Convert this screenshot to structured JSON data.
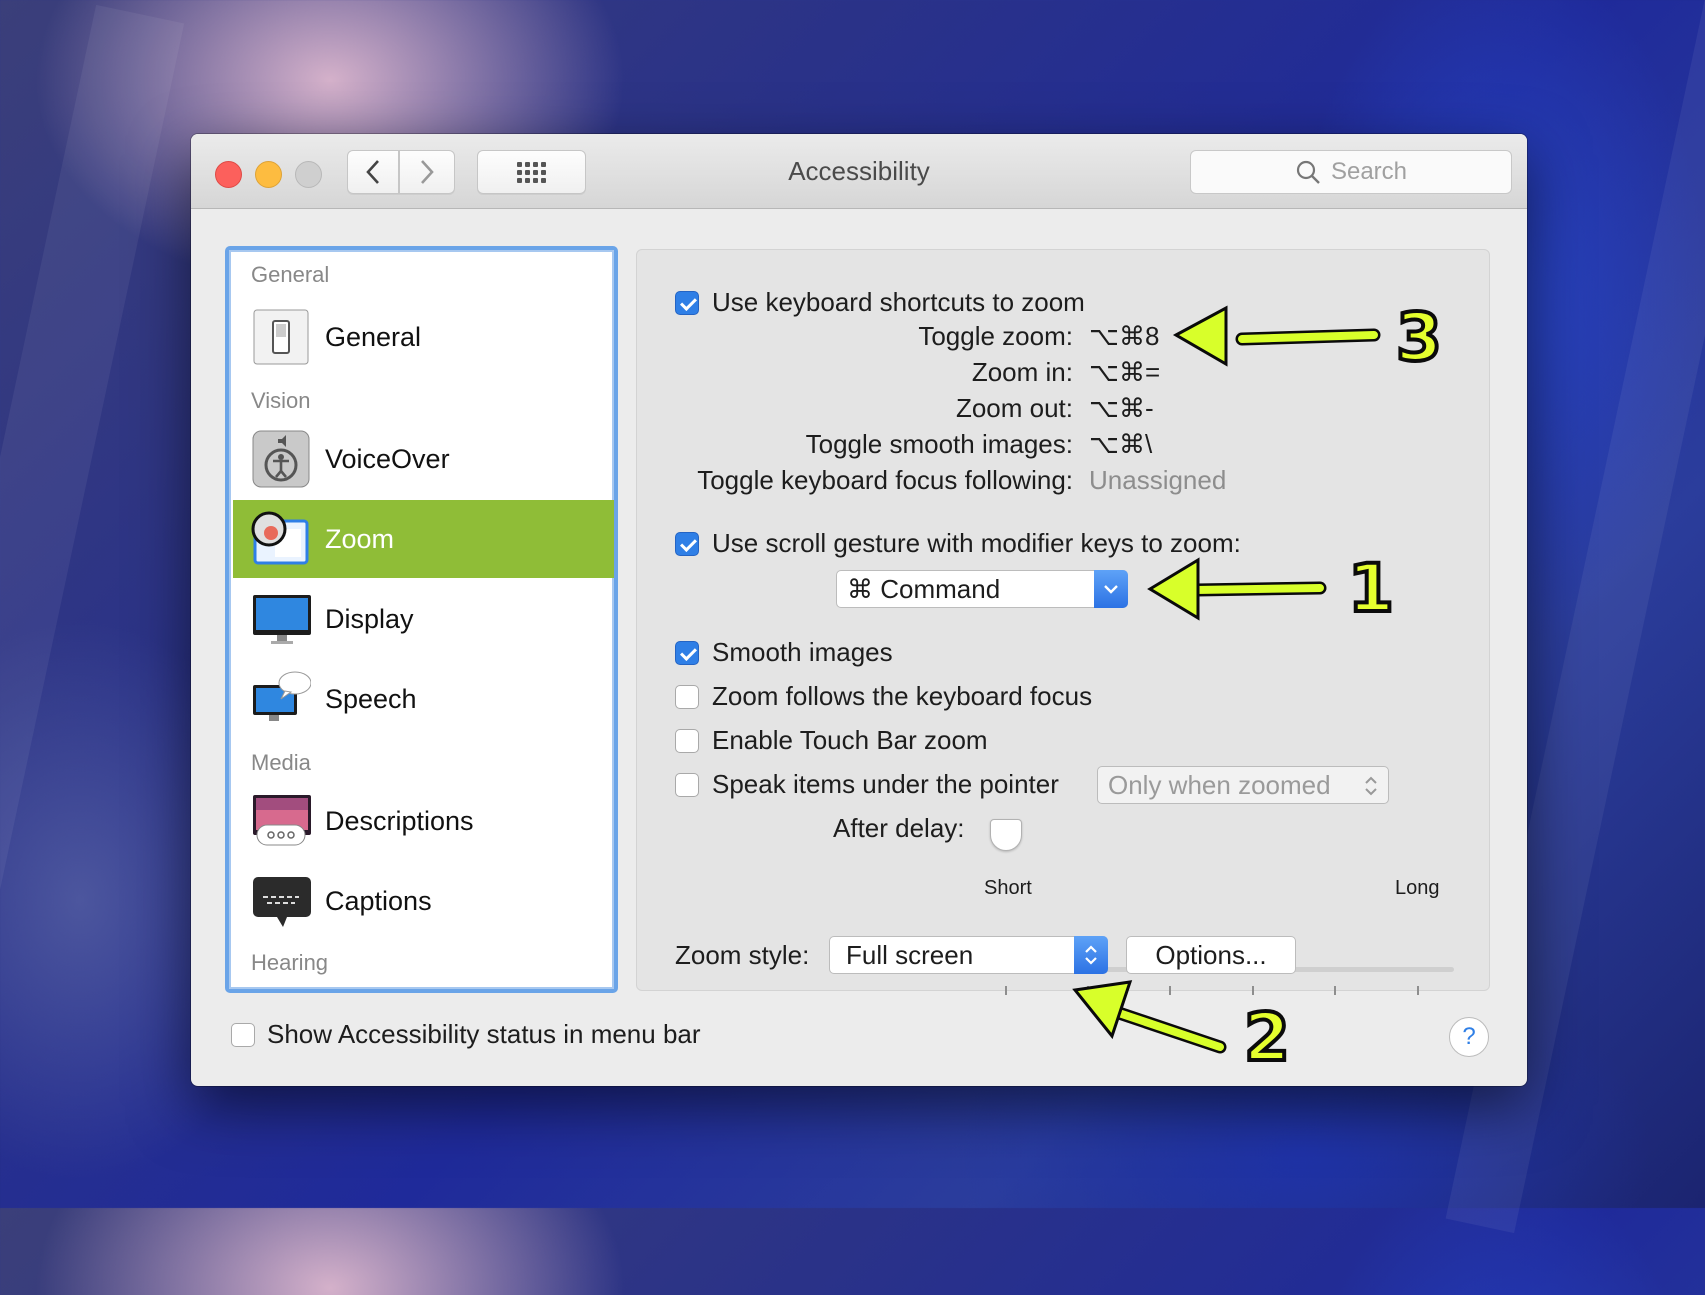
{
  "window": {
    "title": "Accessibility",
    "search_placeholder": "Search"
  },
  "sidebar": {
    "sections": [
      {
        "label": "General"
      },
      {
        "label": "Vision"
      },
      {
        "label": "Media"
      },
      {
        "label": "Hearing"
      }
    ],
    "items": [
      {
        "label": "General",
        "icon": "switch-icon"
      },
      {
        "label": "VoiceOver",
        "icon": "voiceover-icon"
      },
      {
        "label": "Zoom",
        "icon": "zoom-icon",
        "selected": true
      },
      {
        "label": "Display",
        "icon": "display-icon"
      },
      {
        "label": "Speech",
        "icon": "speech-icon"
      },
      {
        "label": "Descriptions",
        "icon": "descriptions-icon"
      },
      {
        "label": "Captions",
        "icon": "captions-icon"
      }
    ],
    "selection_color": "#8fbd37"
  },
  "zoom": {
    "use_keyboard_shortcuts": {
      "label": "Use keyboard shortcuts to zoom",
      "checked": true
    },
    "shortcuts": [
      {
        "label": "Toggle zoom:",
        "value": "⌥⌘8"
      },
      {
        "label": "Zoom in:",
        "value": "⌥⌘="
      },
      {
        "label": "Zoom out:",
        "value": "⌥⌘-"
      },
      {
        "label": "Toggle smooth images:",
        "value": "⌥⌘\\"
      },
      {
        "label": "Toggle keyboard focus following:",
        "value": "Unassigned"
      }
    ],
    "scroll_gesture": {
      "label": "Use scroll gesture with modifier keys to zoom:",
      "checked": true
    },
    "modifier_popup": {
      "value": "⌘ Command"
    },
    "smooth_images": {
      "label": "Smooth images",
      "checked": true
    },
    "follows_focus": {
      "label": "Zoom follows the keyboard focus",
      "checked": false
    },
    "touch_bar_zoom": {
      "label": "Enable Touch Bar zoom",
      "checked": false
    },
    "speak_items": {
      "label": "Speak items under the pointer",
      "checked": false
    },
    "speak_popup": {
      "value": "Only when zoomed"
    },
    "after_delay": {
      "label": "After delay:",
      "min_label": "Short",
      "max_label": "Long",
      "value": 0
    },
    "zoom_style": {
      "label": "Zoom style:",
      "value": "Full screen"
    },
    "options_button": "Options..."
  },
  "footer": {
    "status_menu_bar": {
      "label": "Show Accessibility status in menu bar",
      "checked": false
    },
    "help_label": "?"
  },
  "annotations": [
    {
      "number": "3"
    },
    {
      "number": "1"
    },
    {
      "number": "2"
    }
  ],
  "annotation_color": "#e5ff2e",
  "accent_color": "#2f7fe6"
}
